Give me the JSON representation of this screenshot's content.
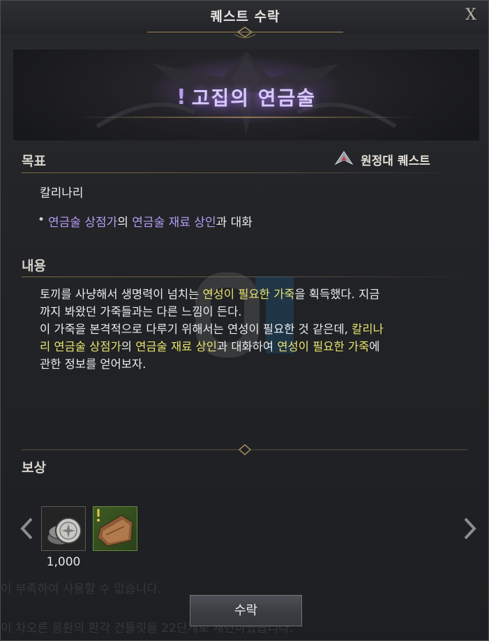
{
  "window": {
    "title": "퀘스트 수락",
    "close_label": "X"
  },
  "banner": {
    "quest_mark": "!",
    "quest_name": "고집의 연금술"
  },
  "goal": {
    "header": "목표",
    "quest_type_label": "원정대 퀘스트",
    "npc_name": "칼리나리",
    "objective": {
      "bullet": "•",
      "part1": "연금술 상점가",
      "part2": "의 ",
      "part3": "연금술 재료 상인",
      "part4": "과 대화"
    }
  },
  "content": {
    "header": "내용",
    "line1_a": "토끼를 사냥해서 생명력이 넘치는 ",
    "line1_b": "연성이 필요한 가죽",
    "line1_c": "을 획득했다. 지금",
    "line2": "까지 봐왔던 가죽들과는 다른 느낌이 든다.",
    "line3_a": "이 가죽을 본격적으로 다루기 위해서는 연성이 필요한 것 같은데, ",
    "line3_b": "칼리나",
    "line4_a": "리 연금술 상점가",
    "line4_b": "의 ",
    "line4_c": "연금술 재료 상인",
    "line4_d": "과 대화하여 ",
    "line4_e": "연성이 필요한 가죽",
    "line4_f": "에",
    "line5": "관한 정보를 얻어보자."
  },
  "reward": {
    "header": "보상",
    "items": [
      {
        "icon": "silver-coins-icon",
        "count": "1,000"
      },
      {
        "icon": "leather-icon",
        "count": ""
      }
    ]
  },
  "background_text": {
    "line1": "이 부족하여 사용할 수 없습니다.",
    "line2": "이 차오른 몽환의 환각 건틀릿을 22단계로 재련하였습니다."
  },
  "accept_button": {
    "label": "수락"
  },
  "colors": {
    "highlight_purple": "#b69cf5",
    "highlight_yellow": "#e9e36e",
    "banner_title": "#d9c9ff",
    "accent_gold": "#8c7a52"
  }
}
